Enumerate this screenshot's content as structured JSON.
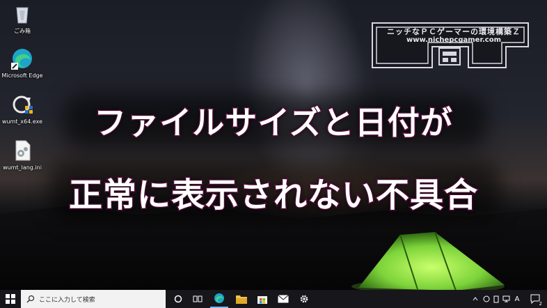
{
  "desktop": {
    "icons": [
      {
        "label": "ごみ箱",
        "icon": "recycle-bin-icon"
      },
      {
        "label": "Microsoft Edge",
        "icon": "edge-icon"
      },
      {
        "label": "wumt_x64.exe",
        "icon": "wumt-exe-icon"
      },
      {
        "label": "wumt_lang.ini",
        "icon": "ini-file-icon"
      }
    ]
  },
  "overlay": {
    "logo_line1": "ニッチなＰＣゲーマーの環境構築Ｚ",
    "logo_line2": "www.nichepcgamer.com",
    "headline_line1": "ファイルサイズと日付が",
    "headline_line2": "正常に表示されない不具合"
  },
  "taskbar": {
    "search_placeholder": "ここに入力して検索",
    "tray_ime": "A",
    "tray_notifications": "2",
    "icons": [
      "windows-start-icon",
      "search-icon",
      "cortana-icon",
      "task-view-icon",
      "edge-icon",
      "file-explorer-icon",
      "store-icon",
      "mail-icon",
      "settings-icon"
    ]
  },
  "colors": {
    "headline_outline": "#6a0f4a",
    "tent_green": "#7dd33a",
    "taskbar_bg": "#17171b"
  }
}
